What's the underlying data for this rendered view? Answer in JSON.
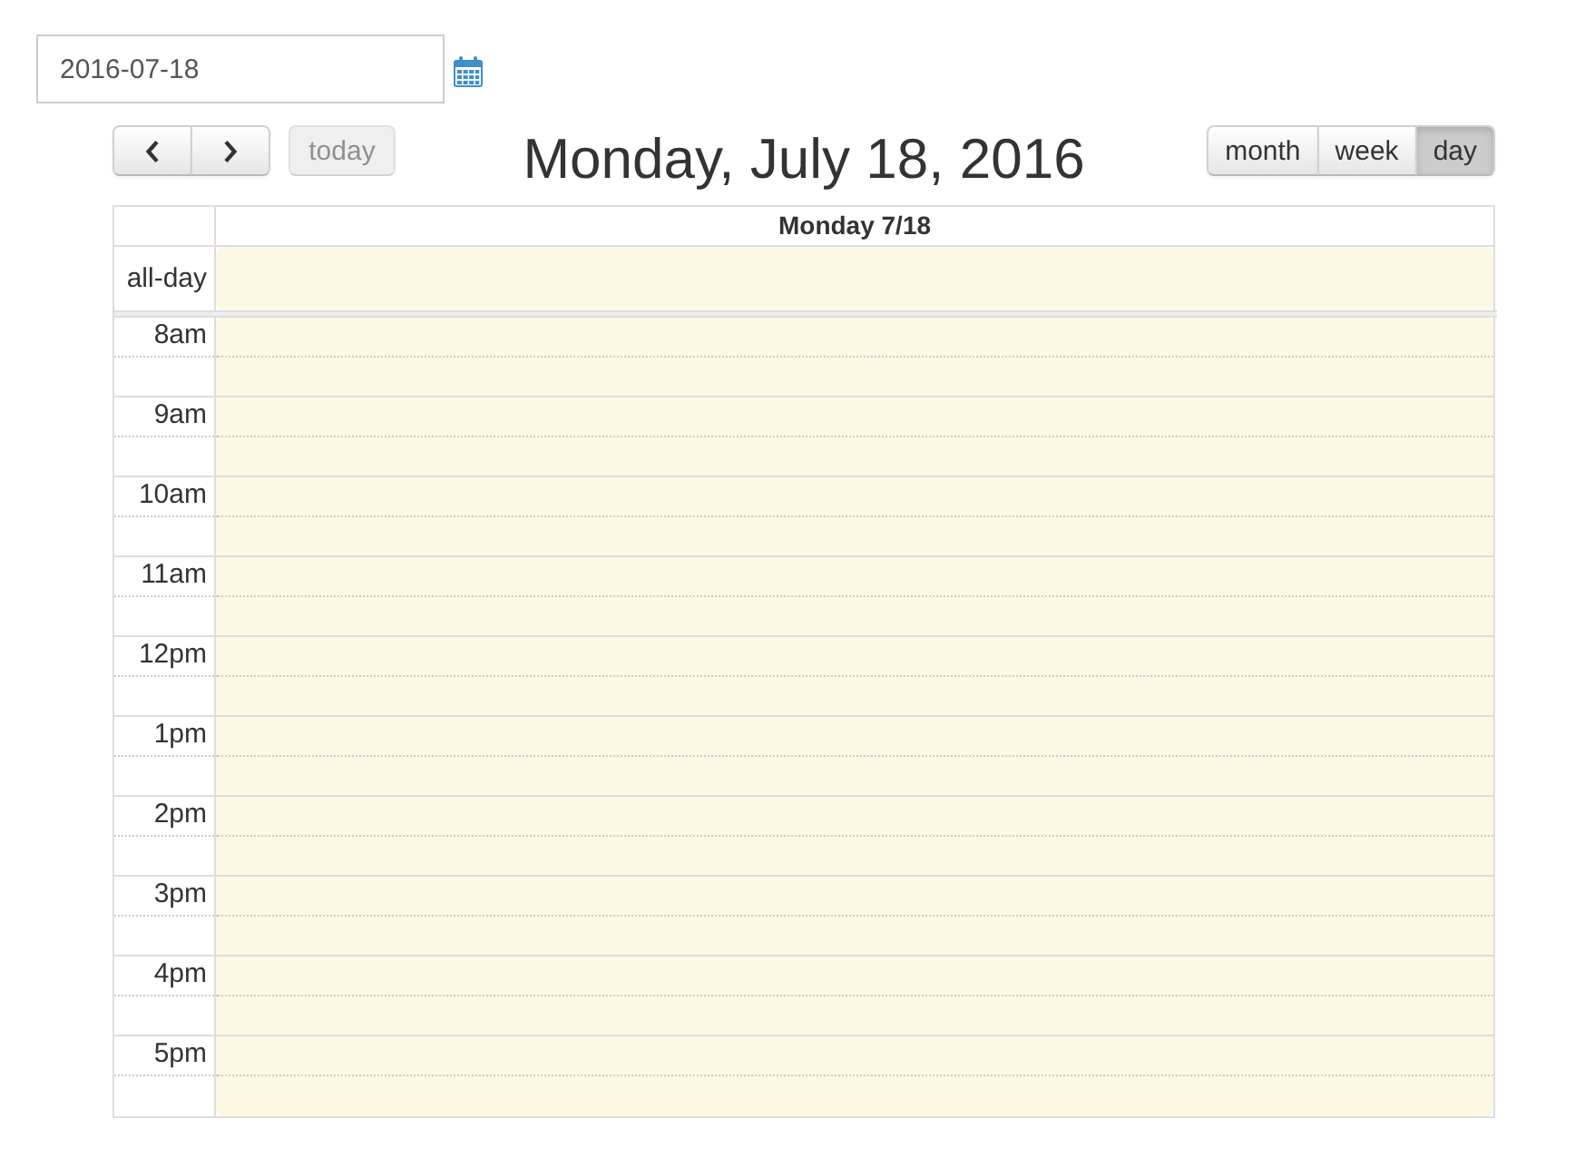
{
  "date_field": {
    "value": "2016-07-18"
  },
  "toolbar": {
    "today_button": {
      "label": "today",
      "disabled": true
    },
    "title": "Monday, July 18, 2016",
    "views": [
      {
        "label": "month",
        "selected": false
      },
      {
        "label": "week",
        "selected": false
      },
      {
        "label": "day",
        "selected": true
      }
    ]
  },
  "calendar": {
    "columns": [
      {
        "heading": "Monday 7/18",
        "today": true
      }
    ],
    "all_day_label": "all-day",
    "hours": [
      "8am",
      "9am",
      "10am",
      "11am",
      "12pm",
      "1pm",
      "2pm",
      "3pm",
      "4pm",
      "5pm"
    ]
  }
}
